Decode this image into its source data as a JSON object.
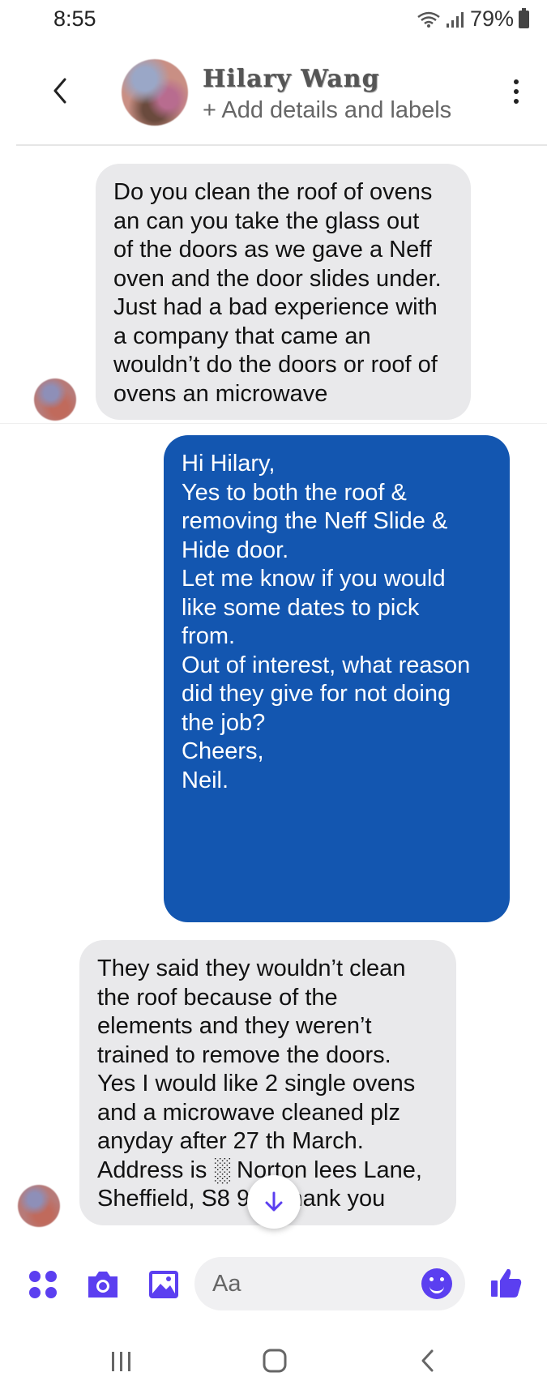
{
  "status_bar": {
    "time": "8:55",
    "battery": "79%"
  },
  "header": {
    "contact_name": "Hilary Wang",
    "subtitle": "+ Add details and labels"
  },
  "messages": [
    {
      "direction": "incoming",
      "lines": [
        "Do you clean the roof of ovens",
        "an can you take the glass out",
        "of the doors as we gave a Neff",
        "oven and the door slides under.",
        "Just had a bad experience with",
        "a company that came an",
        "wouldn’t do the doors or roof of",
        "ovens an microwave"
      ]
    },
    {
      "direction": "outgoing",
      "lines": [
        "Hi Hilary,",
        "",
        "Yes to both the roof &",
        "removing the Neff Slide &",
        "Hide door.",
        "",
        "Let me know if you would",
        "like some dates to pick",
        "from.",
        "",
        "Out of interest, what reason",
        "did they give for not doing",
        "the job?",
        "",
        "Cheers,",
        "Neil."
      ]
    },
    {
      "direction": "incoming",
      "lines": [
        "They said they wouldn’t clean",
        "the roof because of the",
        "elements and they weren’t",
        "trained to remove the doors.",
        "Yes I would like 2 single ovens",
        "and a microwave cleaned plz",
        "anyday after 27 th March.",
        "Address is ░ Norton lees Lane,",
        "Sheffield, S8 9    Thank you"
      ]
    }
  ],
  "composer": {
    "placeholder": "Aa"
  },
  "colors": {
    "accent": "#5b3ff0",
    "outgoing_bubble": "#1356b0",
    "incoming_bubble": "#e9e9eb"
  },
  "icons": [
    "back-arrow-icon",
    "more-options-icon",
    "apps-icon",
    "camera-icon",
    "gallery-icon",
    "emoji-icon",
    "thumbs-up-icon",
    "scroll-down-icon",
    "recent-apps-icon",
    "home-icon",
    "nav-back-icon"
  ]
}
